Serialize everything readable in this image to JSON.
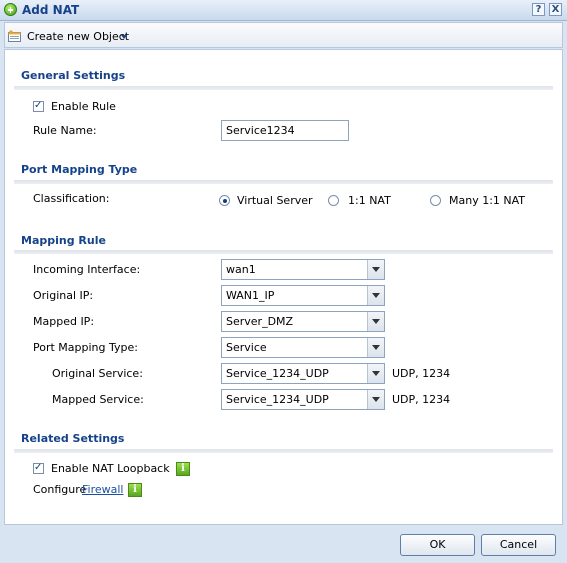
{
  "window": {
    "title": "Add NAT",
    "help_label": "?",
    "close_label": "X"
  },
  "toolbar": {
    "create_object_label": "Create new Object"
  },
  "general": {
    "heading": "General Settings",
    "enable_rule_label": "Enable Rule",
    "enable_rule_checked": true,
    "rule_name_label": "Rule Name:",
    "rule_name_value": "Service1234"
  },
  "port_mapping_type": {
    "heading": "Port Mapping Type",
    "classification_label": "Classification:",
    "options": [
      {
        "label": "Virtual Server",
        "selected": true
      },
      {
        "label": "1:1 NAT",
        "selected": false
      },
      {
        "label": "Many 1:1 NAT",
        "selected": false
      }
    ]
  },
  "mapping_rule": {
    "heading": "Mapping Rule",
    "incoming_interface_label": "Incoming Interface:",
    "incoming_interface_value": "wan1",
    "original_ip_label": "Original IP:",
    "original_ip_value": "WAN1_IP",
    "mapped_ip_label": "Mapped IP:",
    "mapped_ip_value": "Server_DMZ",
    "port_mapping_type_label": "Port Mapping Type:",
    "port_mapping_type_value": "Service",
    "original_service_label": "Original Service:",
    "original_service_value": "Service_1234_UDP",
    "original_service_info": "UDP, 1234",
    "mapped_service_label": "Mapped Service:",
    "mapped_service_value": "Service_1234_UDP",
    "mapped_service_info": "UDP, 1234"
  },
  "related": {
    "heading": "Related Settings",
    "nat_loopback_label": "Enable NAT Loopback",
    "nat_loopback_checked": true,
    "configure_label": "Configure",
    "firewall_link": "Firewall",
    "info_glyph": "i"
  },
  "footer": {
    "ok_label": "OK",
    "cancel_label": "Cancel"
  },
  "icons": {
    "title": "add-circle-icon",
    "toolbar": "create-object-icon",
    "info": "info-icon"
  },
  "colors": {
    "heading": "#15428b",
    "link": "#1c4fa3",
    "info": "#5aa61e"
  }
}
